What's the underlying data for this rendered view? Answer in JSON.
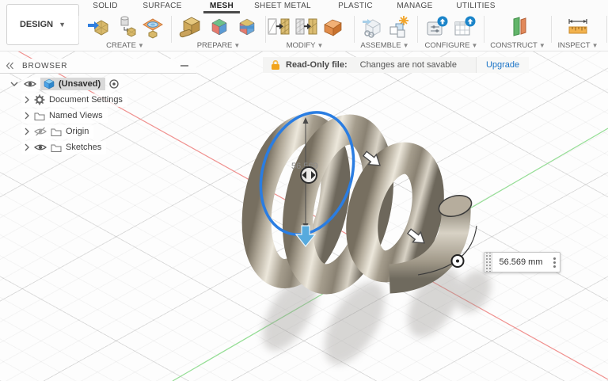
{
  "topbar": {
    "design_label": "DESIGN",
    "tabs": [
      {
        "label": "SOLID"
      },
      {
        "label": "SURFACE"
      },
      {
        "label": "MESH",
        "active": true
      },
      {
        "label": "SHEET METAL"
      },
      {
        "label": "PLASTIC"
      },
      {
        "label": "MANAGE"
      },
      {
        "label": "UTILITIES"
      }
    ],
    "groups": [
      {
        "label": "CREATE"
      },
      {
        "label": "PREPARE"
      },
      {
        "label": "MODIFY"
      },
      {
        "label": "ASSEMBLE"
      },
      {
        "label": "CONFIGURE"
      },
      {
        "label": "CONSTRUCT"
      },
      {
        "label": "INSPECT"
      }
    ]
  },
  "banner": {
    "title": "Read-Only file:",
    "message": "Changes are not savable",
    "action": "Upgrade",
    "lock_color": "#f2a31b",
    "action_color": "#1a73c7"
  },
  "browser": {
    "header": "BROWSER",
    "items": [
      {
        "label": "(Unsaved)",
        "selected": true
      },
      {
        "label": "Document Settings"
      },
      {
        "label": "Named Views"
      },
      {
        "label": "Origin",
        "hidden": true
      },
      {
        "label": "Sketches"
      }
    ]
  },
  "viewport": {
    "dimension_value": "56.569",
    "dimension_input": "56.569 mm",
    "axis_x_color": "#f0908e",
    "axis_y_color": "#95de95",
    "selection_color": "#2a7de2",
    "coil_color": "#b3ab9c"
  }
}
